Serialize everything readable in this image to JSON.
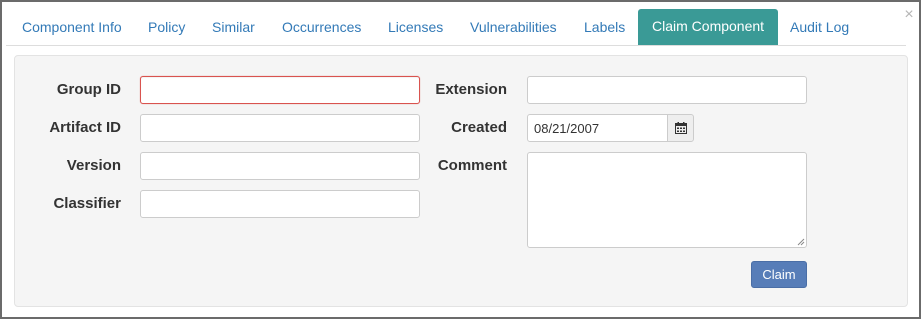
{
  "tabs": [
    {
      "label": "Component Info",
      "active": false
    },
    {
      "label": "Policy",
      "active": false
    },
    {
      "label": "Similar",
      "active": false
    },
    {
      "label": "Occurrences",
      "active": false
    },
    {
      "label": "Licenses",
      "active": false
    },
    {
      "label": "Vulnerabilities",
      "active": false
    },
    {
      "label": "Labels",
      "active": false
    },
    {
      "label": "Claim Component",
      "active": true
    },
    {
      "label": "Audit Log",
      "active": false
    }
  ],
  "close_glyph": "×",
  "form": {
    "group_id": {
      "label": "Group ID",
      "value": "",
      "state": "error"
    },
    "artifact_id": {
      "label": "Artifact ID",
      "value": ""
    },
    "version": {
      "label": "Version",
      "value": ""
    },
    "classifier": {
      "label": "Classifier",
      "value": ""
    },
    "extension": {
      "label": "Extension",
      "value": ""
    },
    "created": {
      "label": "Created",
      "value": "08/21/2007"
    },
    "comment": {
      "label": "Comment",
      "value": ""
    }
  },
  "claim_button": "Claim",
  "icons": {
    "calendar": "calendar-icon",
    "close": "close-icon"
  },
  "colors": {
    "active_tab": "#3a9a96",
    "link": "#337ab7",
    "primary_button": "#577db8",
    "error_border": "#d9534f"
  }
}
